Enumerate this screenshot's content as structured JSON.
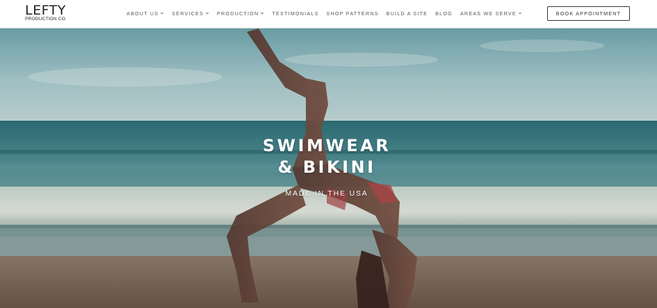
{
  "brand": {
    "name": "LEFTY",
    "tagline": "PRODUCTION CO."
  },
  "nav": {
    "items": [
      {
        "label": "About Us",
        "has_dropdown": true
      },
      {
        "label": "Services",
        "has_dropdown": true
      },
      {
        "label": "Production",
        "has_dropdown": true
      },
      {
        "label": "Testimonials",
        "has_dropdown": false
      },
      {
        "label": "Shop Patterns",
        "has_dropdown": false
      },
      {
        "label": "Build A Site",
        "has_dropdown": false
      },
      {
        "label": "Blog",
        "has_dropdown": false
      },
      {
        "label": "Areas We Serve",
        "has_dropdown": true
      }
    ],
    "cta_label": "Book Appointment"
  },
  "hero": {
    "title_line1": "SWIMWEAR",
    "title_line2": "& BIKINI",
    "subtitle": "Made in the USA",
    "image_subject": "woman-yoga-pose-on-beach"
  },
  "colors": {
    "header_bg": "#ffffff",
    "nav_text": "#555555",
    "sky": "#9fc3c9",
    "ocean": "#3f7e86",
    "sand": "#7d6a5c",
    "hero_text": "#ffffff"
  }
}
